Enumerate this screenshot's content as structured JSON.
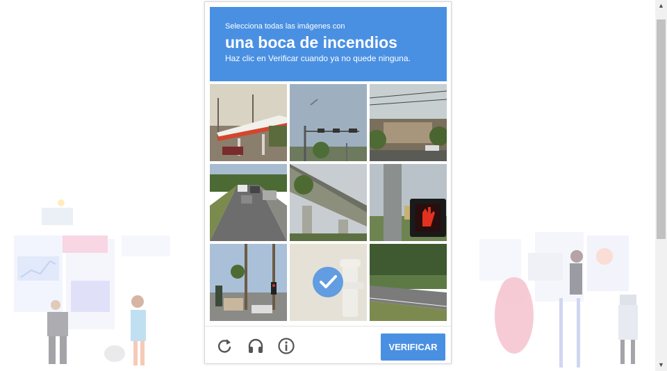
{
  "challenge": {
    "instruction_line1": "Selecciona todas las imágenes con",
    "target_object": "una boca de incendios",
    "instruction_line3": "Haz clic en Verificar cuando ya no quede ninguna."
  },
  "tiles": [
    {
      "content": "gas station",
      "selected": false
    },
    {
      "content": "traffic light pole",
      "selected": false
    },
    {
      "content": "building with trees",
      "selected": false
    },
    {
      "content": "highway traffic",
      "selected": false
    },
    {
      "content": "overpass bridge",
      "selected": false
    },
    {
      "content": "pedestrian signal",
      "selected": false
    },
    {
      "content": "palm trees street",
      "selected": false
    },
    {
      "content": "fire hydrant",
      "selected": true
    },
    {
      "content": "road with grass",
      "selected": false
    }
  ],
  "footer": {
    "reload_icon": "reload-icon",
    "audio_icon": "headphones-icon",
    "info_icon": "info-icon",
    "verify_label": "VERIFICAR"
  },
  "colors": {
    "accent": "#4a90e2"
  }
}
